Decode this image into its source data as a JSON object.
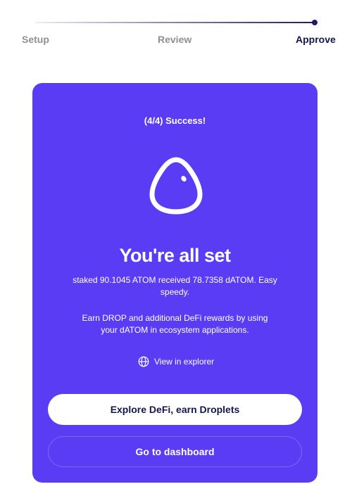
{
  "stepper": {
    "steps": [
      {
        "label": "Setup",
        "state": "complete"
      },
      {
        "label": "Review",
        "state": "complete"
      },
      {
        "label": "Approve",
        "state": "current"
      }
    ],
    "progress": 1.0
  },
  "card": {
    "status": "(4/4) Success!",
    "logo_icon": "drop-icon",
    "headline": "You're all set",
    "summary": "staked 90.1045 ATOM received 78.7358 dATOM. Easy speedy.",
    "promo": "Earn DROP and additional DeFi rewards by using your dATOM in ecosystem applications.",
    "explorer_link": {
      "icon": "globe-icon",
      "label": "View in explorer"
    },
    "primary_button": "Explore DeFi, earn Droplets",
    "secondary_button": "Go to dashboard"
  },
  "colors": {
    "accent": "#5a3cf5",
    "dark_text": "#15154f",
    "muted_text": "#8f8f96"
  }
}
